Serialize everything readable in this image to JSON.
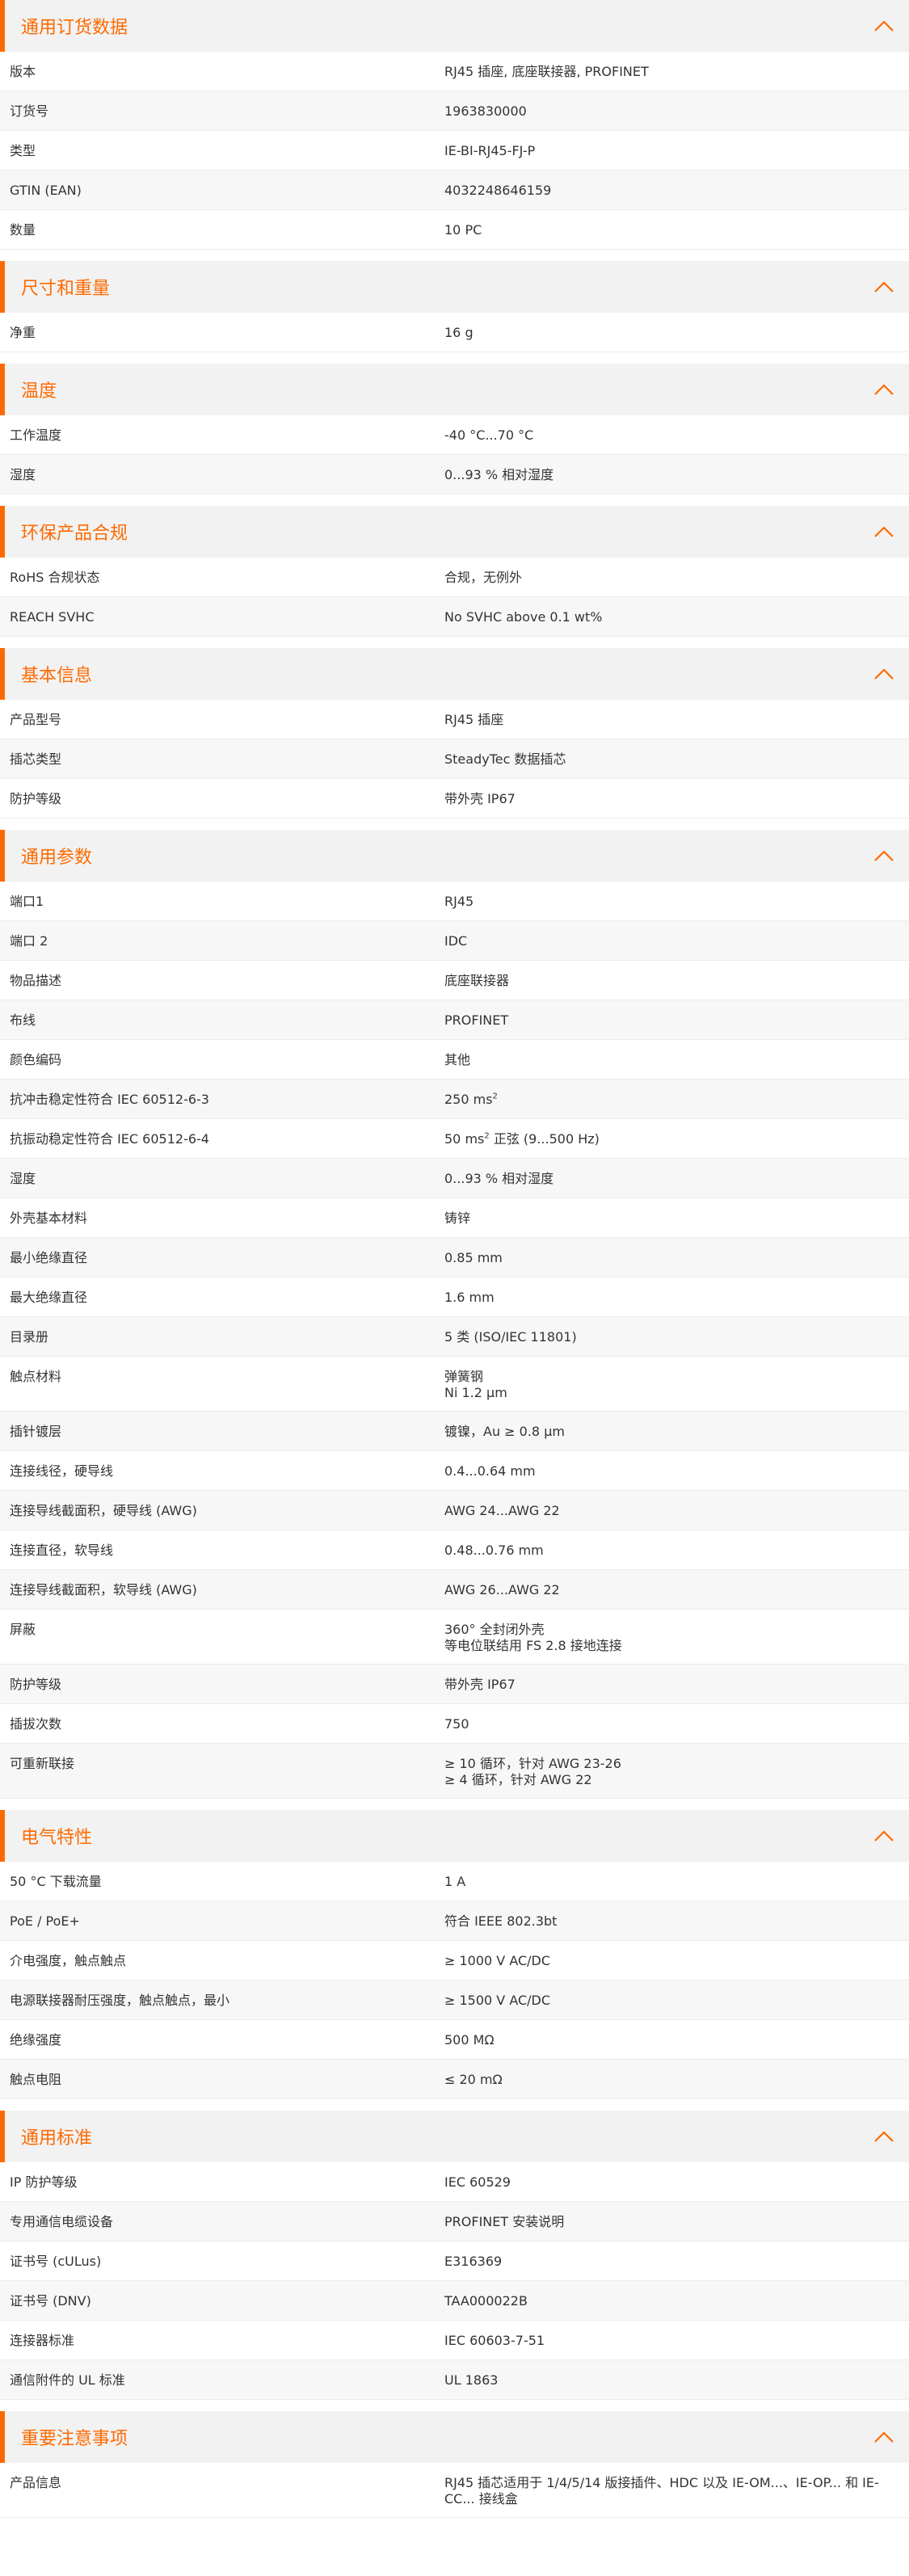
{
  "accent_color": "#ff6a00",
  "toggle_icon": "chevron-up-icon",
  "sections": [
    {
      "title": "通用订货数据",
      "rows": [
        {
          "label": "版本",
          "value": [
            "RJ45 插座, 底座联接器, PROFINET"
          ]
        },
        {
          "label": "订货号",
          "value": [
            "1963830000"
          ]
        },
        {
          "label": "类型",
          "value": [
            "IE-BI-RJ45-FJ-P"
          ]
        },
        {
          "label": "GTIN (EAN)",
          "value": [
            "4032248646159"
          ]
        },
        {
          "label": "数量",
          "value": [
            "10  PC"
          ]
        }
      ]
    },
    {
      "title": "尺寸和重量",
      "rows": [
        {
          "label": "净重",
          "value": [
            "16  g"
          ]
        }
      ]
    },
    {
      "title": "温度",
      "rows": [
        {
          "label": "工作温度",
          "value": [
            "-40 °C...70 °C"
          ]
        },
        {
          "label": "湿度",
          "value": [
            "0...93 % 相对湿度"
          ]
        }
      ]
    },
    {
      "title": "环保产品合规",
      "rows": [
        {
          "label": "RoHS 合规状态",
          "value": [
            "合规，无例外"
          ]
        },
        {
          "label": "REACH SVHC",
          "value": [
            "No SVHC above 0.1 wt%"
          ]
        }
      ]
    },
    {
      "title": "基本信息",
      "rows": [
        {
          "label": "产品型号",
          "value": [
            "RJ45 插座"
          ]
        },
        {
          "label": "插芯类型",
          "value": [
            "SteadyTec 数据插芯"
          ]
        },
        {
          "label": "防护等级",
          "value": [
            "带外壳 IP67"
          ]
        }
      ]
    },
    {
      "title": "通用参数",
      "rows": [
        {
          "label": "端口1",
          "value": [
            "RJ45"
          ]
        },
        {
          "label": "端口 2",
          "value": [
            "IDC"
          ]
        },
        {
          "label": "物品描述",
          "value": [
            "底座联接器"
          ]
        },
        {
          "label": "布线",
          "value": [
            "PROFINET"
          ]
        },
        {
          "label": "颜色编码",
          "value": [
            "其他"
          ]
        },
        {
          "label": "抗冲击稳定性符合 IEC 60512-6-3",
          "value": [
            "250 ms",
            "2",
            ""
          ]
        },
        {
          "label": "抗振动稳定性符合 IEC 60512-6-4",
          "value": [
            "50 ms",
            "2",
            " 正弦 (9...500 Hz)"
          ]
        },
        {
          "label": "湿度",
          "value": [
            "0...93 % 相对湿度"
          ]
        },
        {
          "label": "外壳基本材料",
          "value": [
            "铸锌"
          ]
        },
        {
          "label": "最小绝缘直径",
          "value": [
            "0.85  mm"
          ]
        },
        {
          "label": "最大绝缘直径",
          "value": [
            "1.6  mm"
          ]
        },
        {
          "label": "目录册",
          "value": [
            "5 类 (ISO/IEC 11801)"
          ]
        },
        {
          "label": "触点材料",
          "value": [
            "弹簧钢",
            "Ni 1.2 µm"
          ]
        },
        {
          "label": "插针镀层",
          "value": [
            "镀镍，Au ≥ 0.8 µm"
          ]
        },
        {
          "label": "连接线径，硬导线",
          "value": [
            "0.4...0.64 mm"
          ]
        },
        {
          "label": "连接导线截面积，硬导线 (AWG)",
          "value": [
            "AWG 24...AWG 22"
          ]
        },
        {
          "label": "连接直径，软导线",
          "value": [
            "0.48...0.76 mm"
          ]
        },
        {
          "label": "连接导线截面积，软导线 (AWG)",
          "value": [
            "AWG 26...AWG 22"
          ]
        },
        {
          "label": "屏蔽",
          "value": [
            "360° 全封闭外壳",
            "等电位联结用 FS 2.8 接地连接"
          ]
        },
        {
          "label": "防护等级",
          "value": [
            "带外壳 IP67"
          ]
        },
        {
          "label": "插拔次数",
          "value": [
            "750"
          ]
        },
        {
          "label": "可重新联接",
          "value": [
            "≥ 10 循环，针对 AWG 23-26",
            "≥ 4 循环，针对 AWG 22"
          ]
        }
      ]
    },
    {
      "title": "电气特性",
      "rows": [
        {
          "label": "50 °C 下载流量",
          "value": [
            "1  A"
          ]
        },
        {
          "label": "PoE / PoE+",
          "value": [
            "符合 IEEE 802.3bt"
          ]
        },
        {
          "label": "介电强度，触点触点",
          "value": [
            "≥ 1000 V AC/DC"
          ]
        },
        {
          "label": "电源联接器耐压强度，触点触点，最小",
          "value": [
            "≥ 1500 V AC/DC"
          ]
        },
        {
          "label": "绝缘强度",
          "value": [
            "500 MΩ"
          ]
        },
        {
          "label": "触点电阻",
          "value": [
            "≤ 20 mΩ"
          ]
        }
      ]
    },
    {
      "title": "通用标准",
      "rows": [
        {
          "label": "IP 防护等级",
          "value": [
            "IEC 60529"
          ]
        },
        {
          "label": "专用通信电缆设备",
          "value": [
            "PROFINET 安装说明"
          ]
        },
        {
          "label": "证书号 (cULus)",
          "value": [
            "E316369"
          ]
        },
        {
          "label": "证书号 (DNV)",
          "value": [
            "TAA000022B"
          ]
        },
        {
          "label": "连接器标准",
          "value": [
            "IEC 60603-7-51"
          ]
        },
        {
          "label": "通信附件的 UL 标准",
          "value": [
            "UL 1863"
          ]
        }
      ]
    },
    {
      "title": "重要注意事项",
      "rows": [
        {
          "label": "产品信息",
          "value": [
            "RJ45 插芯适用于 1/4/5/14 版接插件、HDC 以及 IE-OM...、IE-OP... 和 IE-",
            "CC... 接线盒"
          ]
        }
      ]
    }
  ]
}
